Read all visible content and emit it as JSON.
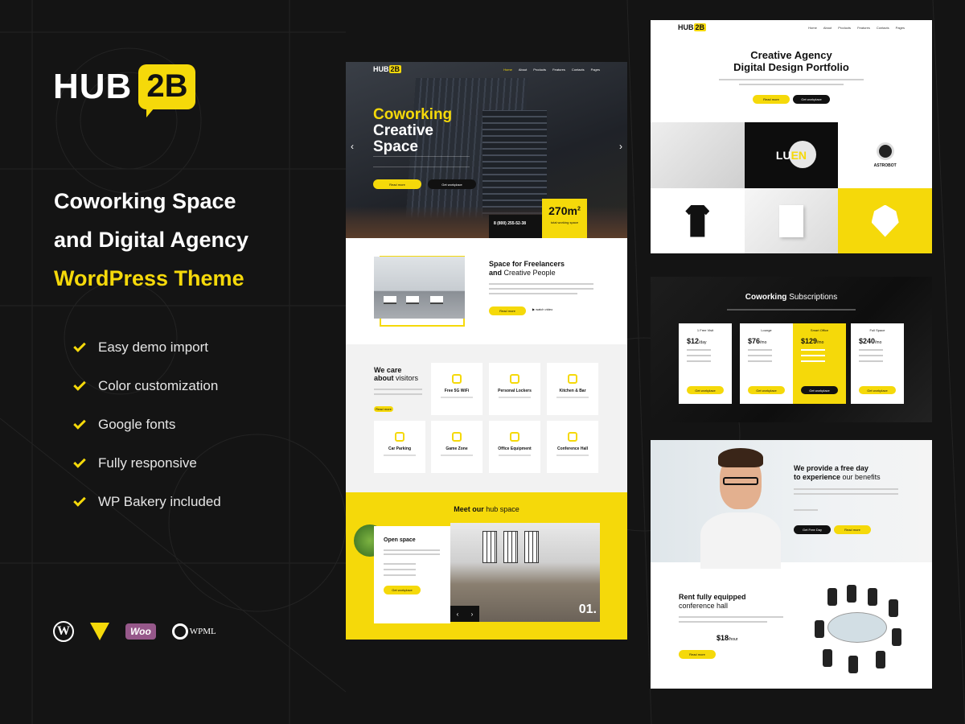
{
  "brand": {
    "hub": "HUB",
    "suffix": "2B"
  },
  "headline": {
    "line1": "Coworking Space",
    "line2": "and Digital Agency",
    "line3": "WordPress Theme"
  },
  "features": [
    "Easy demo import",
    "Color customization",
    "Google fonts",
    "Fully responsive",
    "WP Bakery included"
  ],
  "brand_icons": {
    "wordpress": "W",
    "woo": "Woo",
    "wpml": "WPML"
  },
  "main_demo": {
    "nav": {
      "logo": "HUB",
      "logo_suffix": "2B",
      "items": [
        "Home",
        "About",
        "Products",
        "Features",
        "Contacts",
        "Pages"
      ]
    },
    "hero": {
      "title_y": "Coworking",
      "title_w1": "Creative",
      "title_w2": "Space",
      "btn_read": "Read more",
      "btn_get": "Get workplace",
      "phone": "8 (800) 255-52-38",
      "area": "270m",
      "area_sup": "2",
      "area_label": "total working space"
    },
    "freelance": {
      "title_b": "Space for Freelancers",
      "title_b2": "and",
      "title_l": "Creative People",
      "btn": "Read more",
      "video": "watch video"
    },
    "care": {
      "title_b": "We care",
      "title_b2": "about",
      "title_l": "visitors",
      "btn": "Read more",
      "cards": [
        "Free 5G WiFi",
        "Personal Lockers",
        "Kitchen & Bar",
        "Car Parking",
        "Game Zone",
        "Office Equipment",
        "Conference Hall"
      ]
    },
    "hub": {
      "title_b": "Meet our",
      "title_l": "hub space",
      "box_title": "Open space",
      "box_btn": "Get workplace",
      "num": "01."
    }
  },
  "portfolio": {
    "nav": {
      "logo": "HUB",
      "logo_suffix": "2B",
      "items": [
        "Home",
        "About",
        "Products",
        "Features",
        "Contacts",
        "Pages"
      ]
    },
    "title1": "Creative Agency",
    "title2": "Digital Design Portfolio",
    "btn_read": "Read more",
    "btn_get": "Get workplace",
    "tiles": {
      "lumen": "LU",
      "lumen2": "EN",
      "astro": "ASTROBOT"
    }
  },
  "subscriptions": {
    "title_b": "Coworking",
    "title_l": "Subscriptions",
    "plans": [
      {
        "name": "1 Free Visit",
        "price": "$12",
        "unit": "/day",
        "btn": "Get workplace"
      },
      {
        "name": "Lounge",
        "price": "$76",
        "unit": "/mo",
        "btn": "Get workplace"
      },
      {
        "name": "Smart Office",
        "price": "$129",
        "unit": "/mo",
        "btn": "Get workplace"
      },
      {
        "name": "Full Space",
        "price": "$240",
        "unit": "/mo",
        "btn": "Get workplace"
      }
    ]
  },
  "freeday": {
    "title_b": "We provide a free day",
    "title_b2": "to experience",
    "title_l": "our benefits",
    "btn1": "Get Free Day",
    "btn2": "Read more",
    "conf_b": "Rent fully equipped",
    "conf_l": "conference hall",
    "price": "$18",
    "price_unit": "/hour",
    "btn3": "Read more"
  },
  "colors": {
    "accent": "#f5d90a",
    "dark": "#141414"
  }
}
